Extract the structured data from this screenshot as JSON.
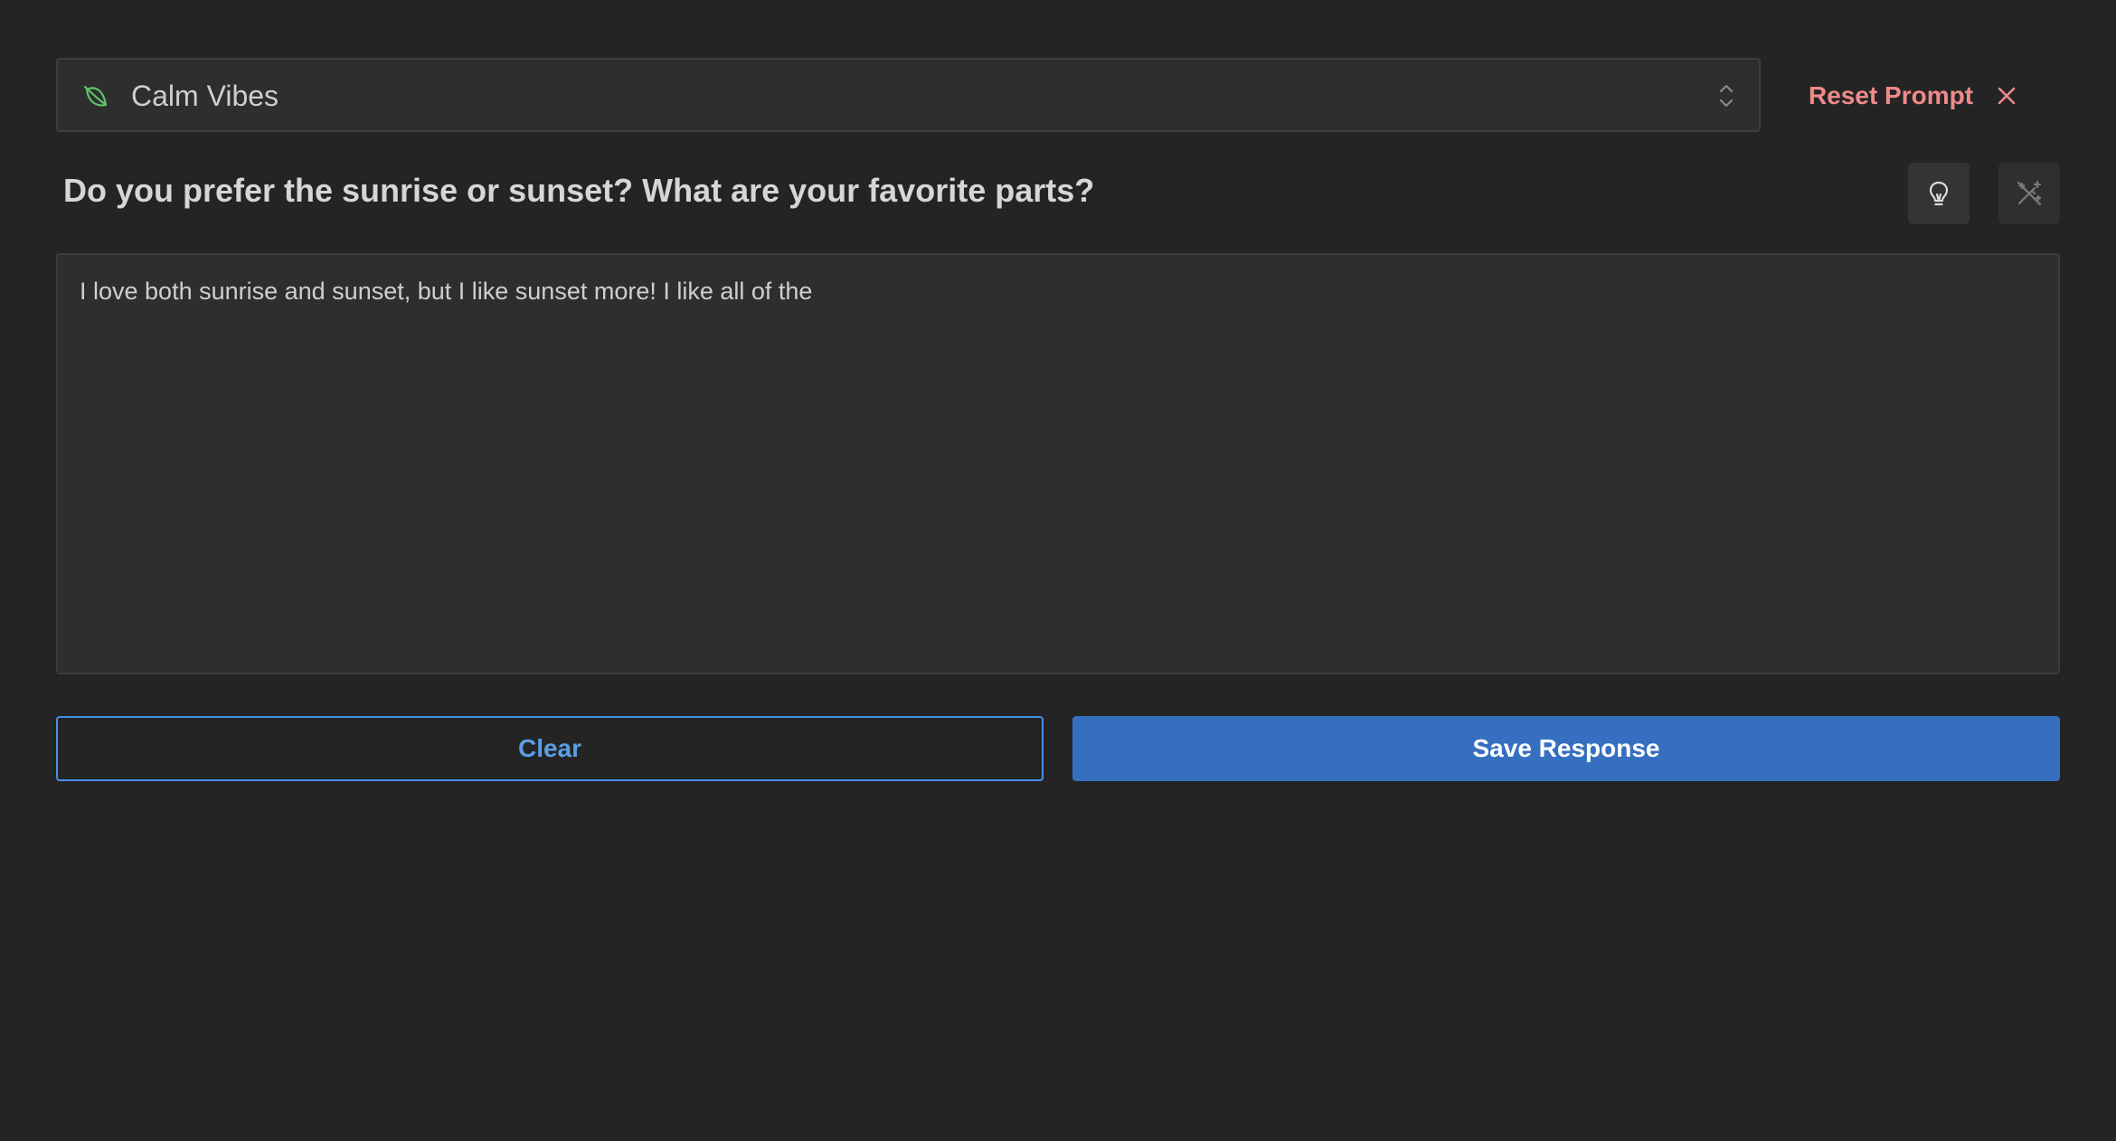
{
  "mood_select": {
    "icon": "leaf-icon",
    "value": "Calm Vibes",
    "indicator_icon": "up-down-chevron-icon",
    "icon_color": "#5cc46a"
  },
  "reset_prompt": {
    "label": "Reset Prompt",
    "icon": "close-icon",
    "color": "#f08a8a"
  },
  "prompt": {
    "question": "Do you prefer the sunrise or sunset? What are your favorite parts?",
    "hint_button_icon": "lightbulb-icon",
    "magic_button_icon": "magic-wand-icon"
  },
  "response": {
    "value": "I love both sunrise and sunset, but I like sunset more! I like all of the"
  },
  "actions": {
    "clear_label": "Clear",
    "save_label": "Save Response",
    "accent_color": "#366fbf"
  }
}
